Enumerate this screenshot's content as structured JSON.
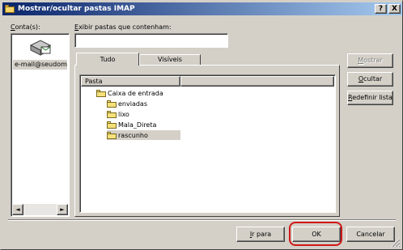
{
  "window": {
    "title": "Mostrar/ocultar pastas IMAP",
    "help_label": "?",
    "close_label": "X"
  },
  "accounts": {
    "label_key": "C",
    "label_rest": "onta(s):",
    "items": [
      {
        "label": "e-mail@seudom..."
      }
    ],
    "scroll_left": "◄",
    "scroll_right": "►"
  },
  "filter": {
    "label_key": "E",
    "label_rest": "xibir pastas que contenham:",
    "value": ""
  },
  "tabs": [
    {
      "label": "Tudo",
      "active": true
    },
    {
      "label": "Visíveis",
      "active": false
    }
  ],
  "tree": {
    "columns": [
      "Pasta",
      ""
    ],
    "root": "Caixa de entrada",
    "children": [
      "enviadas",
      "lixo",
      "Mala_Direta",
      "rascunho"
    ],
    "selected": "rascunho"
  },
  "side_buttons": [
    {
      "key": "M",
      "rest": "ostrar",
      "enabled": false
    },
    {
      "key": "O",
      "rest": "cultar",
      "enabled": true
    },
    {
      "key": "R",
      "rest": "edefinir lista",
      "enabled": true
    }
  ],
  "bottom_buttons": {
    "goto_key": "I",
    "goto_rest": "r para",
    "ok": "OK",
    "cancel": "Cancelar"
  },
  "colors": {
    "face": "#d4d0c8",
    "title_start": "#0a246a",
    "title_end": "#a6caf0",
    "highlight_circle": "#d01818"
  }
}
